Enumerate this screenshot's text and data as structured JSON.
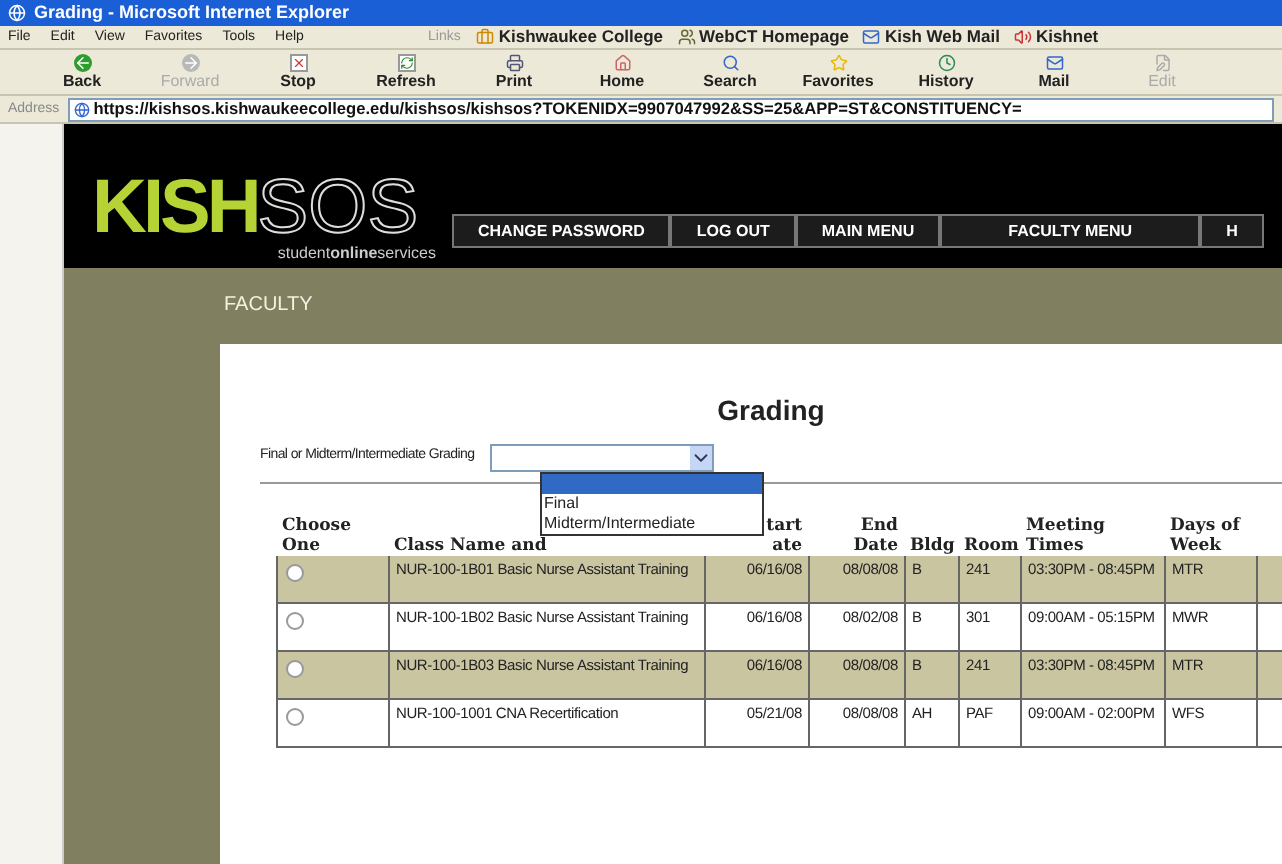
{
  "window": {
    "title": "Grading - Microsoft Internet Explorer"
  },
  "menu": [
    "File",
    "Edit",
    "View",
    "Favorites",
    "Tools",
    "Help"
  ],
  "links": {
    "label": "Links",
    "items": [
      {
        "kind": "college",
        "label": "Kishwaukee College"
      },
      {
        "kind": "webct",
        "label": "WebCT Homepage"
      },
      {
        "kind": "mail",
        "label": "Kish Web Mail"
      },
      {
        "kind": "net",
        "label": "Kishnet"
      }
    ]
  },
  "toolbar": [
    {
      "kind": "back",
      "label": "Back",
      "disabled": false
    },
    {
      "kind": "forward",
      "label": "Forward",
      "disabled": true
    },
    {
      "kind": "stop",
      "label": "Stop",
      "disabled": false
    },
    {
      "kind": "refresh",
      "label": "Refresh",
      "disabled": false
    },
    {
      "kind": "print",
      "label": "Print",
      "disabled": false
    },
    {
      "kind": "home",
      "label": "Home",
      "disabled": false
    },
    {
      "kind": "search",
      "label": "Search",
      "disabled": false
    },
    {
      "kind": "favorites",
      "label": "Favorites",
      "disabled": false
    },
    {
      "kind": "history",
      "label": "History",
      "disabled": false
    },
    {
      "kind": "mail",
      "label": "Mail",
      "disabled": false
    },
    {
      "kind": "edit",
      "label": "Edit",
      "disabled": true
    }
  ],
  "address": {
    "label": "Address",
    "value": "https://kishsos.kishwaukeecollege.edu/kishsos/kishsos?TOKENIDX=9907047992&SS=25&APP=ST&CONSTITUENCY="
  },
  "logo": {
    "brand": "KISH",
    "suffix": "SOS",
    "tagline": "student**online**services"
  },
  "nav": [
    "CHANGE PASSWORD",
    "LOG OUT",
    "MAIN MENU",
    "FACULTY MENU",
    "H"
  ],
  "section": "FACULTY",
  "heading": "Grading",
  "grading_select": {
    "label": "Final or Midterm/Intermediate Grading",
    "expanded": true,
    "options": [
      {
        "selected": true
      },
      {
        "label": "Final",
        "selected": false
      },
      {
        "label": "Midterm/Intermediate",
        "selected": false
      }
    ]
  },
  "table": {
    "columns": [
      [
        "Choose",
        "One"
      ],
      [
        "Class Name and"
      ],
      [
        "tart",
        "ate"
      ],
      [
        "End",
        "Date"
      ],
      [
        "Bldg"
      ],
      [
        "Room"
      ],
      [
        "Meeting",
        "Times"
      ],
      [
        "Days of",
        "Week"
      ]
    ],
    "rows": [
      {
        "highlighted": true,
        "selected": false,
        "class": "NUR-100-1B01 Basic Nurse Assistant Training",
        "start": "06/16/08",
        "end": "08/08/08",
        "bldg": "B",
        "room": "241",
        "times": "03:30PM - 08:45PM",
        "days": "MTR"
      },
      {
        "highlighted": false,
        "selected": false,
        "class": "NUR-100-1B02 Basic Nurse Assistant Training",
        "start": "06/16/08",
        "end": "08/02/08",
        "bldg": "B",
        "room": "301",
        "times": "09:00AM - 05:15PM",
        "days": "MWR"
      },
      {
        "highlighted": true,
        "selected": false,
        "class": "NUR-100-1B03 Basic Nurse Assistant Training",
        "start": "06/16/08",
        "end": "08/08/08",
        "bldg": "B",
        "room": "241",
        "times": "03:30PM - 08:45PM",
        "days": "MTR"
      },
      {
        "highlighted": false,
        "selected": false,
        "class": "NUR-100-1001 CNA Recertification",
        "start": "05/21/08",
        "end": "08/08/08",
        "bldg": "AH",
        "room": "PAF",
        "times": "09:00AM - 02:00PM",
        "days": "WFS"
      }
    ]
  }
}
